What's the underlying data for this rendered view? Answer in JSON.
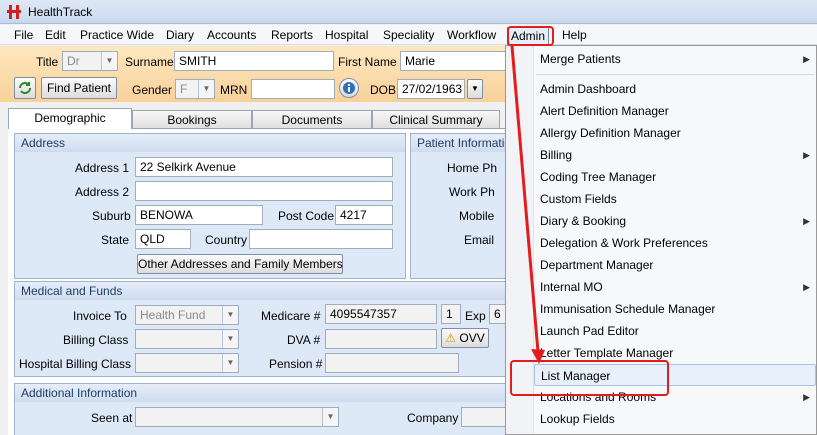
{
  "app": {
    "title": "HealthTrack"
  },
  "menubar": [
    "File",
    "Edit",
    "Practice Wide",
    "Diary",
    "Accounts",
    "Reports",
    "Hospital",
    "Speciality",
    "Workflow",
    "Admin",
    "Help"
  ],
  "patient": {
    "title_label": "Title",
    "title_value": "Dr",
    "surname_label": "Surname",
    "surname_value": "SMITH",
    "firstname_label": "First Name",
    "firstname_value": "Marie",
    "find_button": "Find Patient",
    "gender_label": "Gender",
    "gender_value": "F",
    "mrn_label": "MRN",
    "mrn_value": "",
    "dob_label": "DOB",
    "dob_value": "27/02/1963"
  },
  "tabs": [
    "Demographic",
    "Bookings",
    "Documents",
    "Clinical Summary"
  ],
  "address": {
    "header": "Address",
    "address1_label": "Address 1",
    "address1_value": "22 Selkirk Avenue",
    "address2_label": "Address 2",
    "address2_value": "",
    "suburb_label": "Suburb",
    "suburb_value": "BENOWA",
    "postcode_label": "Post Code",
    "postcode_value": "4217",
    "state_label": "State",
    "state_value": "QLD",
    "country_label": "Country",
    "country_value": "",
    "other_button": "Other Addresses and Family Members"
  },
  "patient_info": {
    "header": "Patient Informatio",
    "home_ph_label": "Home Ph",
    "work_ph_label": "Work Ph",
    "mobile_label": "Mobile",
    "email_label": "Email"
  },
  "medical": {
    "header": "Medical and Funds",
    "invoice_to_label": "Invoice To",
    "invoice_to_value": "Health Fund",
    "billing_class_label": "Billing Class",
    "hospital_billing_class_label": "Hospital Billing Class",
    "medicare_label": "Medicare #",
    "medicare_value": "4095547357",
    "medicare_irn": "1",
    "exp_label": "Exp",
    "exp_value": "6",
    "dva_label": "DVA #",
    "ovv_button": "OVV",
    "pension_label": "Pension #"
  },
  "additional": {
    "header": "Additional Information",
    "seen_at_label": "Seen at",
    "company_label": "Company"
  },
  "admin_menu": {
    "items": [
      {
        "label": "Merge Patients",
        "submenu": true
      },
      {
        "label": "Admin Dashboard",
        "submenu": false
      },
      {
        "label": "Alert Definition Manager",
        "submenu": false
      },
      {
        "label": "Allergy Definition Manager",
        "submenu": false
      },
      {
        "label": "Billing",
        "submenu": true
      },
      {
        "label": "Coding Tree Manager",
        "submenu": false
      },
      {
        "label": "Custom Fields",
        "submenu": false
      },
      {
        "label": "Diary & Booking",
        "submenu": true
      },
      {
        "label": "Delegation & Work Preferences",
        "submenu": false
      },
      {
        "label": "Department Manager",
        "submenu": false
      },
      {
        "label": "Internal MO",
        "submenu": true
      },
      {
        "label": "Immunisation Schedule Manager",
        "submenu": false
      },
      {
        "label": "Launch Pad Editor",
        "submenu": false
      },
      {
        "label": "Letter Template Manager",
        "submenu": false
      },
      {
        "label": "List Manager",
        "submenu": false
      },
      {
        "label": "Locations and Rooms",
        "submenu": true
      },
      {
        "label": "Lookup Fields",
        "submenu": false
      }
    ]
  },
  "colors": {
    "highlight": "#e31d1d",
    "toolbar": "#f7d19a",
    "panel": "#dde9f7"
  },
  "icons": [
    "healthtrack-logo-icon",
    "refresh-icon",
    "info-icon",
    "warning-icon",
    "chevron-down-icon",
    "submenu-arrow-icon"
  ]
}
